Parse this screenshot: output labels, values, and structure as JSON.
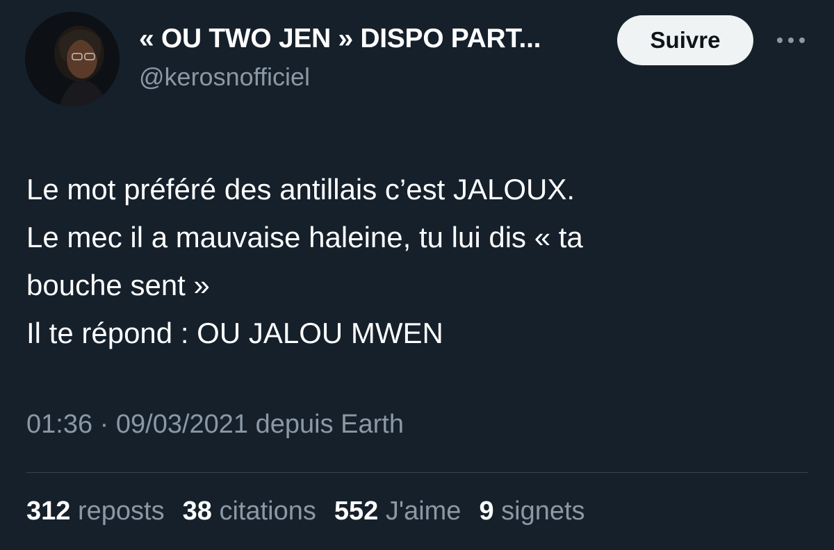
{
  "author": {
    "display_name": "« OU TWO JEN » DISPO PART...",
    "handle": "@kerosnofficiel",
    "avatar_icon": "profile-photo"
  },
  "follow_button": {
    "label": "Suivre"
  },
  "more_button": {
    "icon": "more-horizontal-icon"
  },
  "tweet": {
    "lines": [
      "Le mot préféré des antillais c’est JALOUX.",
      "Le mec il a mauvaise haleine, tu lui dis « ta",
      "bouche sent »",
      "Il te répond : OU JALOU MWEN"
    ]
  },
  "meta": {
    "time": "01:36",
    "separator": "·",
    "date": "09/03/2021",
    "source": "depuis Earth"
  },
  "stats": {
    "reposts": {
      "count": "312",
      "label": "reposts"
    },
    "quotes": {
      "count": "38",
      "label": "citations"
    },
    "likes": {
      "count": "552",
      "label": "J'aime"
    },
    "bookmarks": {
      "count": "9",
      "label": "signets"
    }
  },
  "colors": {
    "background": "#15202b",
    "primary_text": "#ffffff",
    "secondary_text": "#8b98a5",
    "button_bg": "#eff3f4",
    "divider": "#38444d"
  }
}
